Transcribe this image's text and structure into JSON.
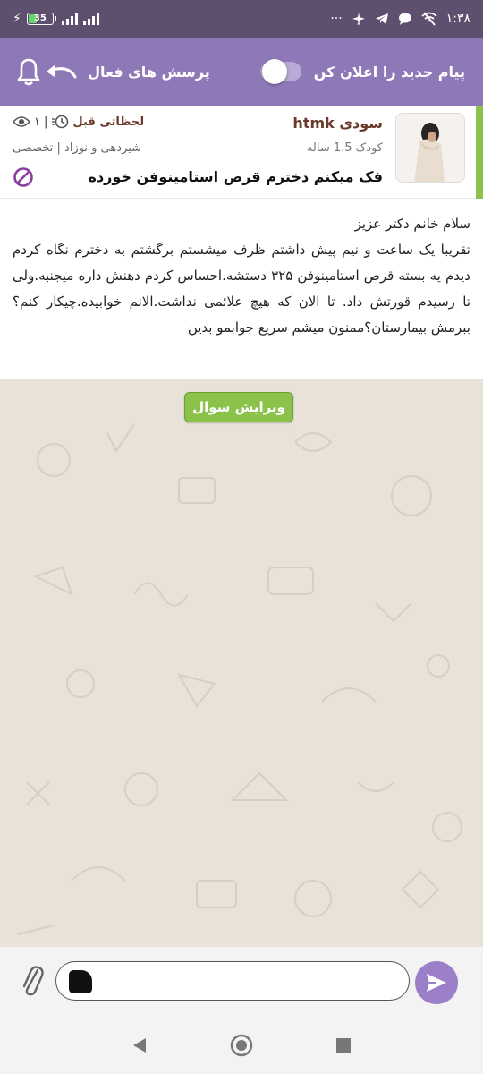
{
  "status_bar": {
    "battery": "35",
    "time": "۱:۳۸",
    "dots": "···"
  },
  "header": {
    "notify_label": "پیام جدید را اعلان کن",
    "active_questions_label": "پرسش های فعال",
    "notify_enabled": false
  },
  "question": {
    "user_name": "سودی htmk",
    "child_age": "کودک 1.5 ساله",
    "title": "فک میکنم دخترم قرص استامینوفن خورده",
    "time_ago": "لحظاتی قبل",
    "views": "۱",
    "category": "شیردهی و نوزاد | تخصصی",
    "greeting": "سلام خانم دکتر عزیز",
    "body": "تقریبا یک ساعت و نیم پیش داشتم ظرف میشستم برگشتم به دخترم نگاه کردم دیدم یه بسته قرص استامینوفن ۳۲۵ دستشه.احساس کردم دهنش داره میجنبه.ولی تا رسیدم قورتش داد. تا الان که هیچ علائمی نداشت.الانم خوابیده.چیکار کنم؟ببرمش بیمارستان؟ممنون میشم سریع جوابمو بدین"
  },
  "edit_button_label": "ویرایش سوال",
  "input": {
    "value": ""
  },
  "colors": {
    "header": "#8f78b8",
    "status_bar": "#5f4f6e",
    "accent_green": "#8bc34a",
    "send": "#9b80c9",
    "name": "#6b3a2a"
  },
  "icons": [
    "bell-icon",
    "back-arrow-icon",
    "eye-icon",
    "clock-icon",
    "block-icon",
    "attach-icon",
    "emoji-icon",
    "send-icon"
  ]
}
